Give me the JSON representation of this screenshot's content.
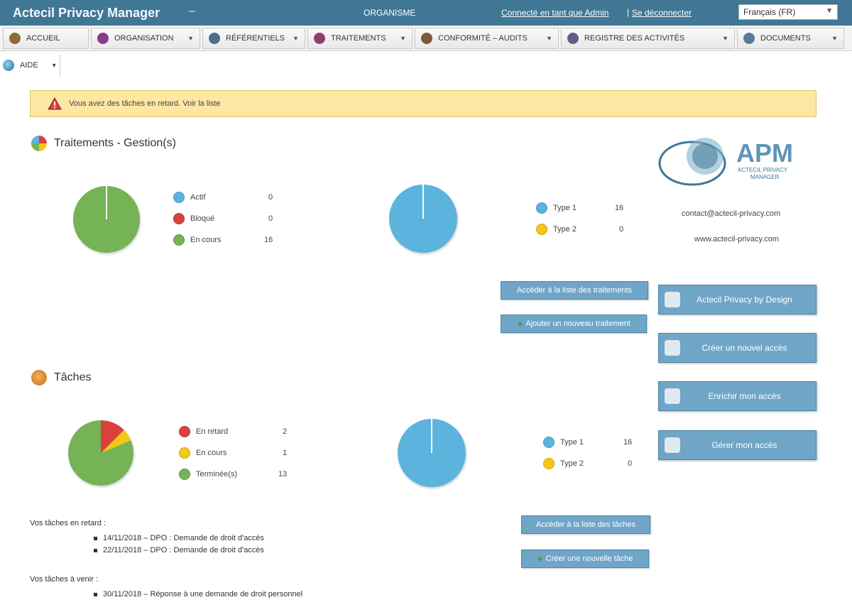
{
  "header": {
    "app_title": "Actecil Privacy Manager",
    "dash": "–",
    "organization": "ORGANISME",
    "user_link": "Connecté en tant que Admin",
    "separator": "|",
    "logout_link": "Se déconnecter",
    "language": {
      "selected": "Français (FR)"
    }
  },
  "menu": {
    "items": [
      {
        "label": "ACCUEIL",
        "icon": "home-icon",
        "color": "#8c6d3a"
      },
      {
        "label": "ORGANISATION",
        "icon": "organisation-icon",
        "color": "#8a3a8a"
      },
      {
        "label": "RÉFÉRENTIELS",
        "icon": "referentiels-icon",
        "color": "#4a6f8a"
      },
      {
        "label": "TRAITEMENTS",
        "icon": "traitements-icon",
        "color": "#8e3f73"
      },
      {
        "label": "CONFORMITÉ – AUDITS",
        "icon": "audits-icon",
        "color": "#7a5a3a"
      },
      {
        "label": "REGISTRE DES ACTIVITÉS",
        "icon": "registre-icon",
        "color": "#6a5a8a"
      },
      {
        "label": "DOCUMENTS",
        "icon": "documents-icon",
        "color": "#5a7a9a"
      }
    ],
    "second_row": {
      "label": "AIDE",
      "icon": "help-icon"
    }
  },
  "alert": {
    "text": "Vous avez des tâches en retard. Voir la liste"
  },
  "traitements": {
    "title": "Traitements - Gestion(s)",
    "legend": [
      {
        "label": "Actif",
        "value": "0",
        "color": "#5bb3de"
      },
      {
        "label": "Bloqué",
        "value": "0",
        "color": "#d9413e"
      },
      {
        "label": "En cours",
        "value": "16",
        "color": "#76b256"
      }
    ],
    "legend2": [
      {
        "label": "Type 1",
        "value": "16",
        "color": "#5bb3de"
      },
      {
        "label": "Type 2",
        "value": "0",
        "color": "#f3c718"
      }
    ],
    "btn_list": "Accéder à la liste des traitements",
    "btn_add": "Ajouter un nouveau traitement"
  },
  "taches": {
    "title": "Tâches",
    "legend": [
      {
        "label": "En retard",
        "value": "2",
        "color": "#d9413e"
      },
      {
        "label": "En cours",
        "value": "1",
        "color": "#f3c718"
      },
      {
        "label": "Terminée(s)",
        "value": "13",
        "color": "#76b256"
      }
    ],
    "legend2": [
      {
        "label": "Type 1",
        "value": "16",
        "color": "#5bb3de"
      },
      {
        "label": "Type 2",
        "value": "0",
        "color": "#f3c718"
      }
    ],
    "btn_list": "Accéder à la liste des tâches",
    "btn_add": "Créer une nouvelle tâche"
  },
  "side": {
    "contact_email": "contact@actecil-privacy.com",
    "website": "www.actecil-privacy.com",
    "buttons": [
      {
        "label": "Actecil Privacy by Design",
        "icon": "design-icon"
      },
      {
        "label": "Créer un nouvel accès",
        "icon": "access-icon"
      },
      {
        "label": "Enrichir mon accès",
        "icon": "enrich-icon"
      },
      {
        "label": "Gérer mon accès",
        "icon": "manage-icon"
      }
    ]
  },
  "overdue": {
    "heading": "Vos tâches en retard :",
    "items": [
      "14/11/2018 – DPO : Demande de droit d'accès",
      "22/11/2018 – DPO : Demande de droit d'accès"
    ]
  },
  "upcoming": {
    "heading": "Vos tâches à venir :",
    "items": [
      "30/11/2018 – Réponse à une demande de droit personnel"
    ]
  },
  "colors": {
    "accent": "#3f7795",
    "button": "#6fa6c8",
    "alert": "#fde7a3"
  }
}
